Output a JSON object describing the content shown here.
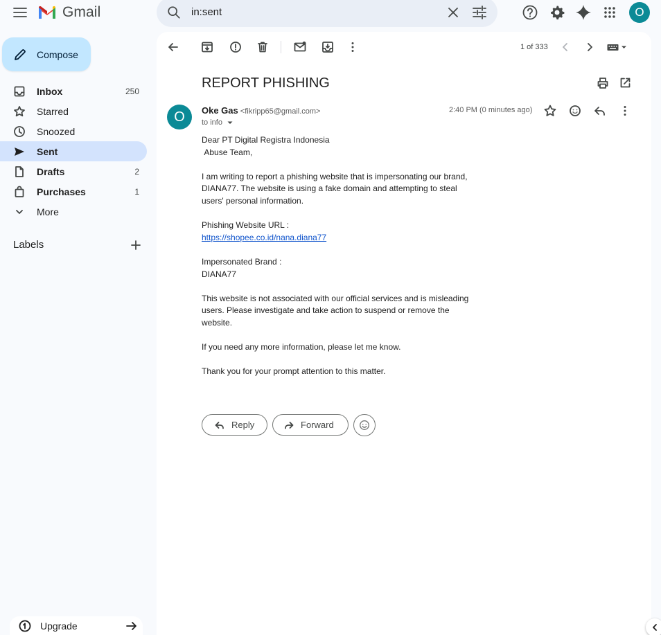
{
  "app": {
    "name": "Gmail"
  },
  "search": {
    "query": "in:sent"
  },
  "compose": {
    "label": "Compose"
  },
  "nav": [
    {
      "label": "Inbox",
      "count": "250",
      "icon": "inbox-icon"
    },
    {
      "label": "Starred",
      "count": "",
      "icon": "star-icon"
    },
    {
      "label": "Snoozed",
      "count": "",
      "icon": "clock-icon"
    },
    {
      "label": "Sent",
      "count": "",
      "icon": "send-icon",
      "active": true
    },
    {
      "label": "Drafts",
      "count": "2",
      "icon": "draft-icon"
    },
    {
      "label": "Purchases",
      "count": "1",
      "icon": "shopping-bag-icon"
    },
    {
      "label": "More",
      "count": "",
      "icon": "chevron-down-icon"
    }
  ],
  "labels": {
    "title": "Labels"
  },
  "upgrade": {
    "label": "Upgrade"
  },
  "pager": {
    "text": "1 of 333"
  },
  "email": {
    "subject": "REPORT PHISHING",
    "sender_initial": "O",
    "sender_name": "Oke Gas",
    "sender_email": "<fikripp65@gmail.com>",
    "to": "to info",
    "timestamp": "2:40 PM (0 minutes ago)",
    "body": {
      "greeting": "Dear PT Digital Registra Indonesia",
      "greeting2": " Abuse Team,",
      "para1": "I am writing to report a phishing website that is impersonating our brand, DIANA77. The website is using a fake domain and attempting to steal users' personal information.",
      "url_label": "Phishing Website URL :",
      "url": "https://shopee.co.id/nana.diana77",
      "brand_label": "Impersonated Brand :",
      "brand": "DIANA77",
      "para2": "This website is not associated with our official services and is misleading users. Please investigate and take action to suspend or remove the website.",
      "para3": "If you need any more information, please let me know.",
      "para4": "Thank you for your prompt attention to this matter."
    }
  },
  "actions": {
    "reply": "Reply",
    "forward": "Forward"
  },
  "account": {
    "initial": "O"
  },
  "colors": {
    "accent": "#c2e7ff",
    "active_nav": "#d3e3fd",
    "avatar": "#0b8a96",
    "link": "#1155cc"
  }
}
